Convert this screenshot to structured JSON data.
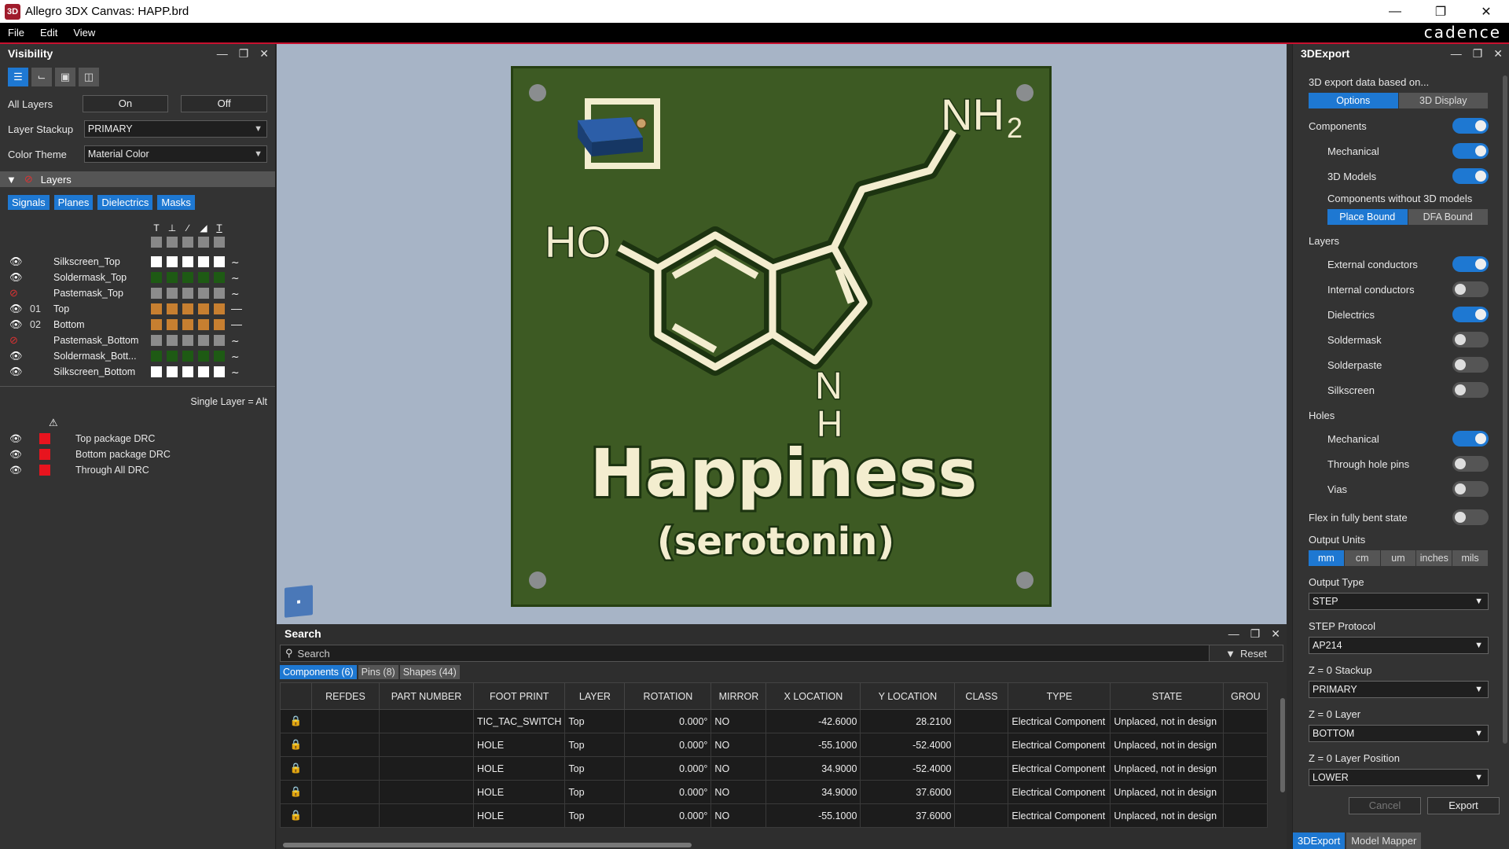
{
  "window": {
    "title": "Allegro 3DX Canvas: HAPP.brd",
    "app_icon_text": "3D"
  },
  "menu": {
    "items": [
      "File",
      "Edit",
      "View"
    ],
    "brand": "cadence"
  },
  "visibility": {
    "title": "Visibility",
    "all_layers_label": "All Layers",
    "on_label": "On",
    "off_label": "Off",
    "stackup_label": "Layer Stackup",
    "stackup_value": "PRIMARY",
    "theme_label": "Color Theme",
    "theme_value": "Material Color",
    "layers_header": "Layers",
    "tabs": [
      "Signals",
      "Planes",
      "Dielectrics",
      "Masks"
    ],
    "layers": [
      {
        "num": "",
        "name": "Silkscreen_Top",
        "color": "#ffffff",
        "visible": true
      },
      {
        "num": "",
        "name": "Soldermask_Top",
        "color": "#1e5a14",
        "visible": true
      },
      {
        "num": "",
        "name": "Pastemask_Top",
        "color": "#8c8c8c",
        "visible": false
      },
      {
        "num": "01",
        "name": "Top",
        "color": "#c77f30",
        "visible": true
      },
      {
        "num": "02",
        "name": "Bottom",
        "color": "#c77f30",
        "visible": true
      },
      {
        "num": "",
        "name": "Pastemask_Bottom",
        "color": "#8c8c8c",
        "visible": false
      },
      {
        "num": "",
        "name": "Soldermask_Bott...",
        "color": "#1e5a14",
        "visible": true
      },
      {
        "num": "",
        "name": "Silkscreen_Bottom",
        "color": "#ffffff",
        "visible": true
      }
    ],
    "single_layer_hint": "Single Layer = Alt",
    "drc": [
      "Top package DRC",
      "Bottom package DRC",
      "Through All DRC"
    ]
  },
  "board": {
    "nh2": "NH",
    "nh2_sub": "2",
    "ho": "HO",
    "n": "N",
    "h": "H",
    "title": "Happiness",
    "subtitle": "(serotonin)",
    "board_color": "#3d5a23",
    "silk_color": "#f3edcf"
  },
  "search": {
    "title": "Search",
    "placeholder": "Search",
    "reset_label": "Reset",
    "tabs": [
      "Components (6)",
      "Pins (8)",
      "Shapes (44)"
    ],
    "columns": [
      "",
      "REFDES",
      "PART NUMBER",
      "FOOT PRINT",
      "LAYER",
      "ROTATION",
      "MIRROR",
      "X LOCATION",
      "Y LOCATION",
      "CLASS",
      "TYPE",
      "STATE",
      "GROU"
    ],
    "rows": [
      [
        "",
        "",
        "TIC_TAC_SWITCH",
        "Top",
        "0.000°",
        "NO",
        "-42.6000",
        "28.2100",
        "",
        "Electrical Component",
        "Unplaced, not in design",
        ""
      ],
      [
        "",
        "",
        "HOLE",
        "Top",
        "0.000°",
        "NO",
        "-55.1000",
        "-52.4000",
        "",
        "Electrical Component",
        "Unplaced, not in design",
        ""
      ],
      [
        "",
        "",
        "HOLE",
        "Top",
        "0.000°",
        "NO",
        "34.9000",
        "-52.4000",
        "",
        "Electrical Component",
        "Unplaced, not in design",
        ""
      ],
      [
        "",
        "",
        "HOLE",
        "Top",
        "0.000°",
        "NO",
        "34.9000",
        "37.6000",
        "",
        "Electrical Component",
        "Unplaced, not in design",
        ""
      ],
      [
        "",
        "",
        "HOLE",
        "Top",
        "0.000°",
        "NO",
        "-55.1000",
        "37.6000",
        "",
        "Electrical Component",
        "Unplaced, not in design",
        ""
      ]
    ]
  },
  "export": {
    "title": "3DExport",
    "based_on": "3D export data based on...",
    "mode_tabs": [
      "Options",
      "3D Display"
    ],
    "components_label": "Components",
    "components_on": true,
    "mechanical_label": "Mechanical",
    "mechanical_on": true,
    "models_label": "3D Models",
    "models_on": true,
    "without_models_label": "Components without 3D models",
    "bound_tabs": [
      "Place Bound",
      "DFA Bound"
    ],
    "layers_label": "Layers",
    "layer_toggles": [
      {
        "label": "External conductors",
        "on": true
      },
      {
        "label": "Internal conductors",
        "on": false
      },
      {
        "label": "Dielectrics",
        "on": true
      },
      {
        "label": "Soldermask",
        "on": false
      },
      {
        "label": "Solderpaste",
        "on": false
      },
      {
        "label": "Silkscreen",
        "on": false
      }
    ],
    "holes_label": "Holes",
    "hole_toggles": [
      {
        "label": "Mechanical",
        "on": true
      },
      {
        "label": "Through hole pins",
        "on": false
      },
      {
        "label": "Vias",
        "on": false
      }
    ],
    "flex_label": "Flex in fully bent state",
    "flex_on": false,
    "units_label": "Output Units",
    "units": [
      "mm",
      "cm",
      "um",
      "inches",
      "mils"
    ],
    "units_selected": "mm",
    "type_label": "Output Type",
    "type_value": "STEP",
    "protocol_label": "STEP Protocol",
    "protocol_value": "AP214",
    "z_stackup_label": "Z = 0 Stackup",
    "z_stackup_value": "PRIMARY",
    "z_layer_label": "Z = 0 Layer",
    "z_layer_value": "BOTTOM",
    "z_pos_label": "Z = 0 Layer Position",
    "z_pos_value": "LOWER",
    "cancel_label": "Cancel",
    "export_label": "Export",
    "bottom_tabs": [
      "3DExport",
      "Model Mapper"
    ]
  }
}
